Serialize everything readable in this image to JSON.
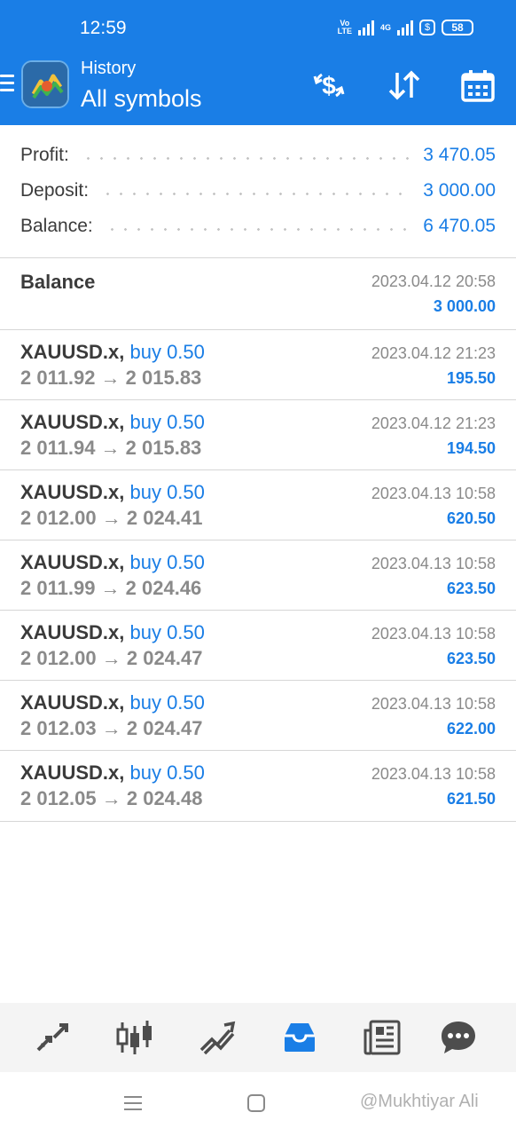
{
  "status_bar": {
    "time": "12:59",
    "volte_label": "Vo LTE",
    "network_label": "4G",
    "battery": "58"
  },
  "header": {
    "subtitle": "History",
    "title": "All symbols",
    "icons": [
      "menu-icon",
      "metatrader-logo",
      "dollar-refresh-icon",
      "sort-arrows-icon",
      "calendar-icon"
    ]
  },
  "summary": [
    {
      "label": "Profit:",
      "value": "3 470.05"
    },
    {
      "label": "Deposit:",
      "value": "3 000.00"
    },
    {
      "label": "Balance:",
      "value": "6 470.05"
    }
  ],
  "balance_entry": {
    "title": "Balance",
    "date": "2023.04.12 20:58",
    "amount": "3 000.00"
  },
  "deals": [
    {
      "symbol": "XAUUSD.x,",
      "side": "buy 0.50",
      "prices": "2 011.92 → 2 015.83",
      "date": "2023.04.12 21:23",
      "profit": "195.50"
    },
    {
      "symbol": "XAUUSD.x,",
      "side": "buy 0.50",
      "prices": "2 011.94 → 2 015.83",
      "date": "2023.04.12 21:23",
      "profit": "194.50"
    },
    {
      "symbol": "XAUUSD.x,",
      "side": "buy 0.50",
      "prices": "2 012.00 → 2 024.41",
      "date": "2023.04.13 10:58",
      "profit": "620.50"
    },
    {
      "symbol": "XAUUSD.x,",
      "side": "buy 0.50",
      "prices": "2 011.99 → 2 024.46",
      "date": "2023.04.13 10:58",
      "profit": "623.50"
    },
    {
      "symbol": "XAUUSD.x,",
      "side": "buy 0.50",
      "prices": "2 012.00 → 2 024.47",
      "date": "2023.04.13 10:58",
      "profit": "623.50"
    },
    {
      "symbol": "XAUUSD.x,",
      "side": "buy 0.50",
      "prices": "2 012.03 → 2 024.47",
      "date": "2023.04.13 10:58",
      "profit": "622.00"
    },
    {
      "symbol": "XAUUSD.x,",
      "side": "buy 0.50",
      "prices": "2 012.05 → 2 024.48",
      "date": "2023.04.13 10:58",
      "profit": "621.50"
    }
  ],
  "bottom_nav": [
    "quotes-icon",
    "chart-icon",
    "trade-icon",
    "history-icon",
    "news-icon",
    "chat-icon"
  ],
  "active_tab": "history-icon",
  "watermark": "@Mukhtiyar Ali",
  "colors": {
    "accent": "#1a7ee6",
    "text": "#3b3b3b",
    "muted": "#8a8a8a"
  }
}
